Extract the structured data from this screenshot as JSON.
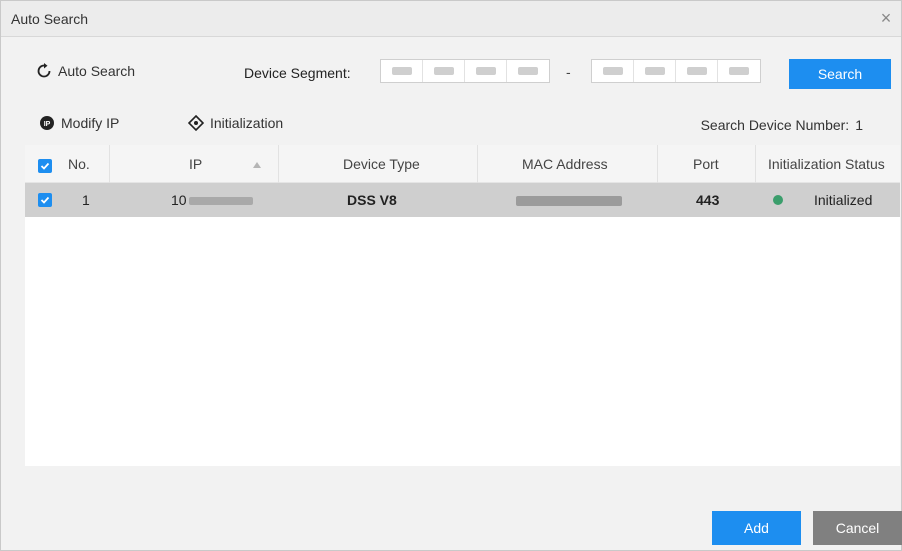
{
  "window": {
    "title": "Auto Search",
    "close_symbol": "×"
  },
  "toolbar": {
    "auto_search_label": "Auto Search",
    "device_segment_label": "Device Segment:",
    "segment_separator": "-",
    "search_label": "Search"
  },
  "actions": {
    "modify_ip_label": "Modify IP",
    "initialization_label": "Initialization",
    "device_count_label": "Search Device Number:",
    "device_count": "1"
  },
  "table": {
    "headers": {
      "no": "No.",
      "ip": "IP",
      "device_type": "Device Type",
      "mac": "MAC Address",
      "port": "Port",
      "status": "Initialization Status"
    },
    "rows": [
      {
        "no": "1",
        "ip_prefix": "10",
        "device_type": "DSS V8",
        "port": "443",
        "status": "Initialized"
      }
    ]
  },
  "footer": {
    "add_label": "Add",
    "cancel_label": "Cancel"
  },
  "colors": {
    "accent": "#1d8ef0",
    "cancel": "#808080",
    "selected_row": "#cfcfcf",
    "status_ok": "#3b9e6c"
  }
}
